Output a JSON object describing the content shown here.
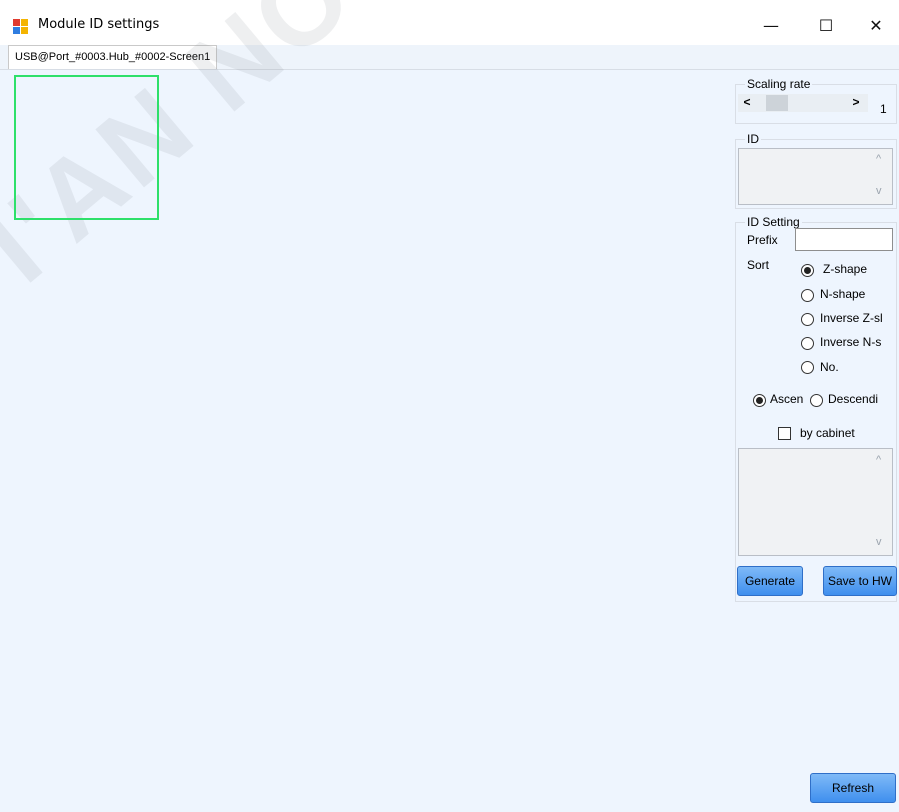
{
  "window": {
    "title": "Module ID settings",
    "min_icon": "—",
    "max_icon": "☐",
    "close_icon": "✕"
  },
  "tabs": [
    {
      "label": "USB@Port_#0003.Hub_#0002-Screen1",
      "active": true
    }
  ],
  "watermark": "I'AN NOVASTAR",
  "scaling": {
    "label": "Scaling rate",
    "value": "1",
    "left_arrow": "<",
    "right_arrow": ">"
  },
  "id_group": {
    "label": "ID",
    "up": "^",
    "down": "v"
  },
  "id_setting": {
    "label": "ID Setting",
    "prefix_label": "Prefix",
    "prefix_value": "",
    "sort_label": "Sort",
    "sort_options": [
      "Z-shape",
      "N-shape",
      "Inverse Z-sl",
      "Inverse N-s",
      "No."
    ],
    "sort_selected": "Z-shape",
    "order_options": [
      "Ascen",
      "Descendi"
    ],
    "order_selected": "Ascen",
    "by_cabinet_label": "by cabinet",
    "by_cabinet_checked": false,
    "list_up": "^",
    "list_down": "v"
  },
  "buttons": {
    "generate": "Generate",
    "save": "Save to HW",
    "refresh": "Refresh"
  },
  "colors": {
    "module_border": "#2ee06a",
    "button_blue": "#3f8fee",
    "content_bg": "#eef5fe"
  }
}
